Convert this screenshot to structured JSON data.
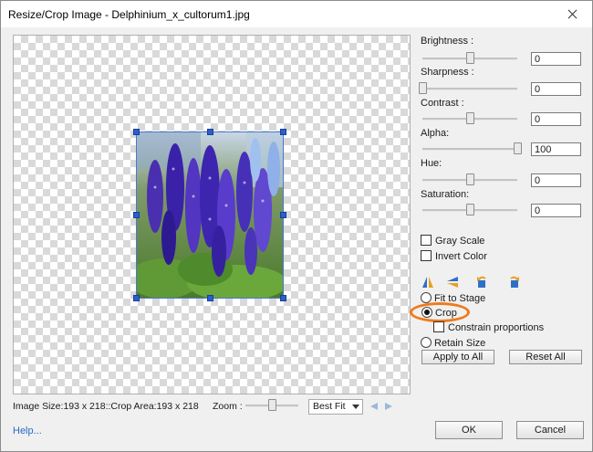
{
  "window": {
    "title": "Resize/Crop Image - Delphinium_x_cultorum1.jpg"
  },
  "adjustments": [
    {
      "key": "brightness",
      "label": "Brightness :",
      "value": "0",
      "level": 0.5
    },
    {
      "key": "sharpness",
      "label": "Sharpness :",
      "value": "0",
      "level": 0.0
    },
    {
      "key": "contrast",
      "label": "Contrast :",
      "value": "0",
      "level": 0.5
    },
    {
      "key": "alpha",
      "label": "Alpha:",
      "value": "100",
      "level": 1.0
    },
    {
      "key": "hue",
      "label": "Hue:",
      "value": "0",
      "level": 0.5
    },
    {
      "key": "saturation",
      "label": "Saturation:",
      "value": "0",
      "level": 0.5
    }
  ],
  "options": {
    "gray_scale": "Gray Scale",
    "invert_color": "Invert Color",
    "fit_to_stage": "Fit to Stage",
    "crop": "Crop",
    "constrain_proportions": "Constrain proportions",
    "retain_size": "Retain Size",
    "selected_mode": "crop"
  },
  "buttons": {
    "apply_all": "Apply to All",
    "reset_all": "Reset All",
    "ok": "OK",
    "cancel": "Cancel"
  },
  "status": {
    "info": "Image Size:193 x 218::Crop Area:193 x 218"
  },
  "zoom": {
    "label": "Zoom :",
    "selected": "Best Fit",
    "level": 0.5
  },
  "help": {
    "label": "Help..."
  },
  "colors": {
    "highlight_ring": "#f07a1a",
    "handle": "#2a5fd0",
    "link": "#2a6ac0"
  }
}
